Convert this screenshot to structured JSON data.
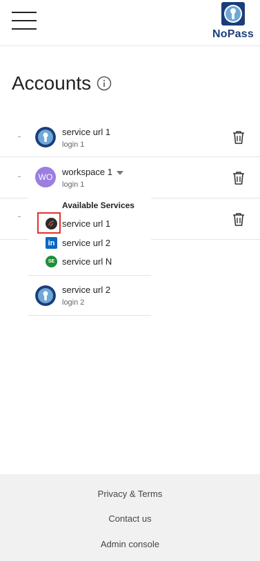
{
  "header": {
    "menu_icon": "hamburger-menu-icon",
    "logo_icon": "keyhole-logo-icon",
    "logo_text": "NoPass",
    "brand_color": "#1a3e7a"
  },
  "page": {
    "title": "Accounts",
    "info_icon": "info-icon"
  },
  "background_rows": [
    {
      "delete_icon": "trash-icon"
    },
    {
      "delete_icon": "trash-icon"
    },
    {
      "delete_icon": "trash-icon"
    }
  ],
  "dropdown": {
    "accounts": [
      {
        "title": "service url 1",
        "subtitle": "login 1",
        "icon": "keyhole-icon"
      },
      {
        "title": "workspace 1",
        "subtitle": "login 1",
        "avatar_text": "WO",
        "icon": "caret-down-icon"
      },
      {
        "title": "service url 2",
        "subtitle": "login 2",
        "icon": "keyhole-icon"
      }
    ],
    "available_services_label": "Available Services",
    "services": [
      {
        "label": "service url 1",
        "icon": "dark-app-icon"
      },
      {
        "label": "service url 2",
        "icon": "linkedin-icon",
        "icon_text": "in"
      },
      {
        "label": "service url N",
        "icon": "se-icon",
        "icon_text": "SE"
      }
    ]
  },
  "footer": {
    "links": [
      "Privacy & Terms",
      "Contact us",
      "Admin console"
    ]
  },
  "colors": {
    "accent": "#1a3e7a",
    "workspace_avatar": "#9b7ee0",
    "highlight": "#e0302c",
    "footer_bg": "#f1f1f1"
  }
}
